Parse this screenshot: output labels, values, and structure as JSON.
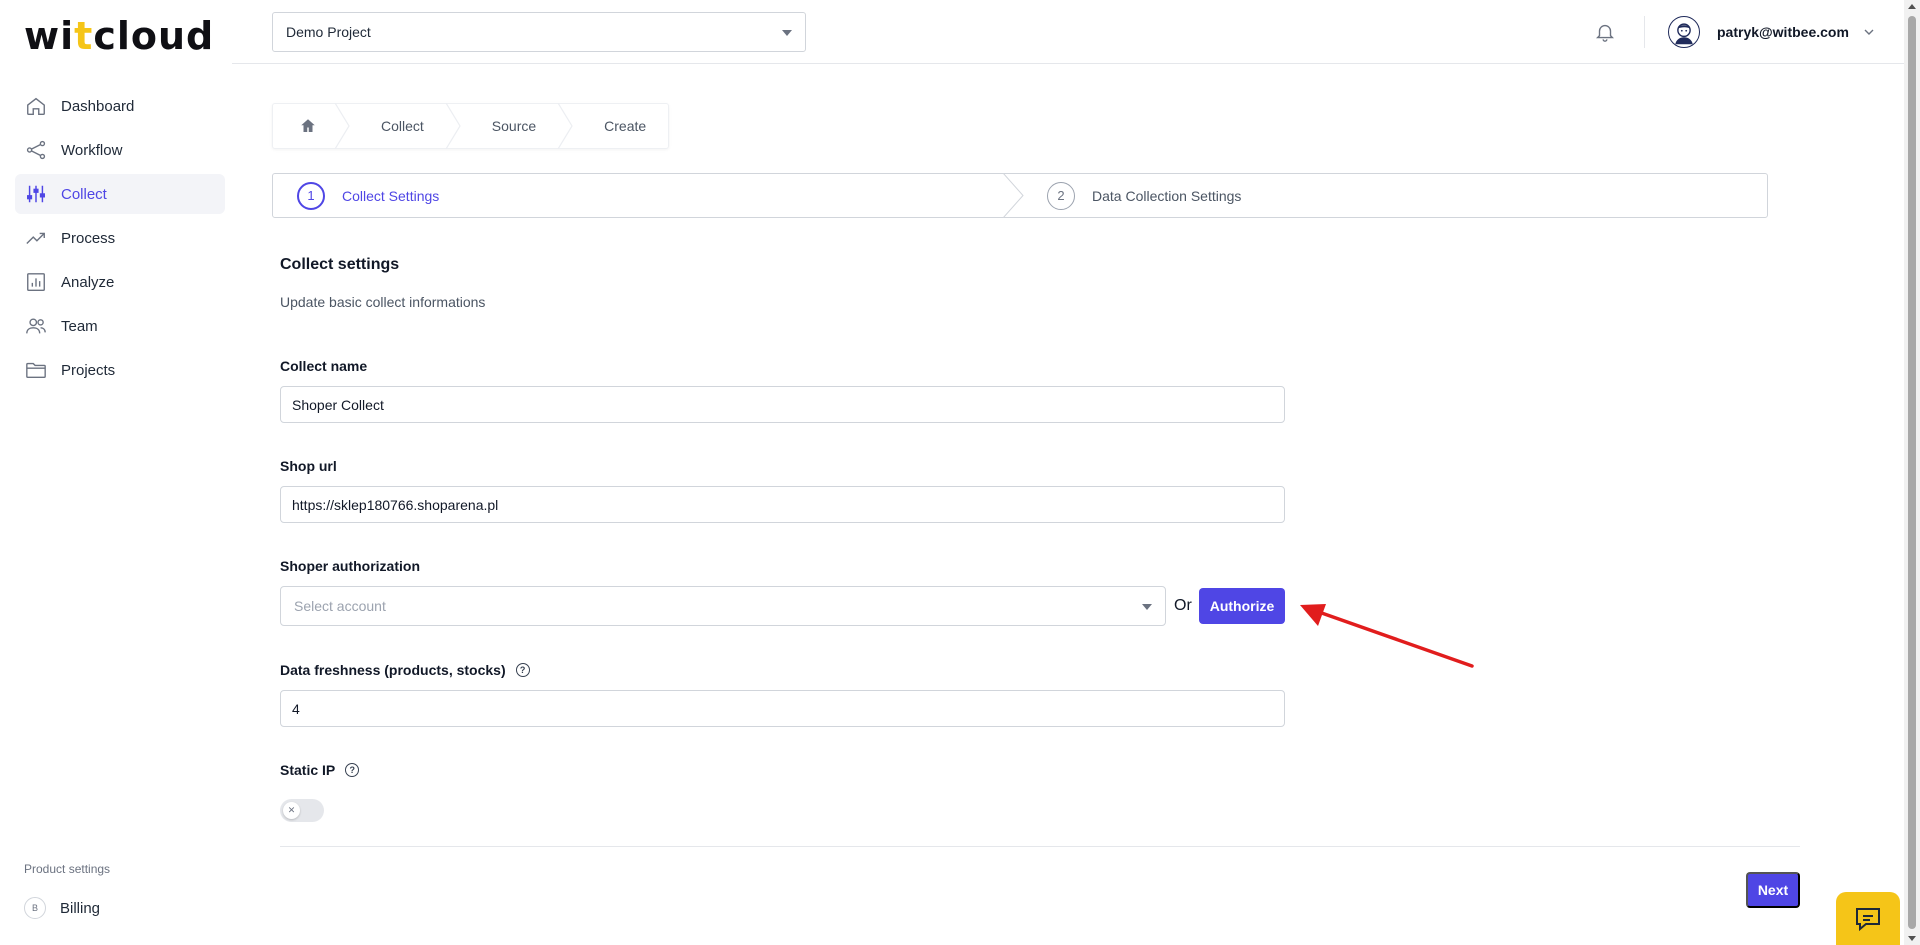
{
  "brand": {
    "logo_pre": "wi",
    "logo_accent": "t",
    "logo_post": "cloud",
    "accent_color": "#f5c518",
    "primary_color": "#4f46e5"
  },
  "sidebar": {
    "items": [
      {
        "label": "Dashboard",
        "icon": "home-icon"
      },
      {
        "label": "Workflow",
        "icon": "share-nodes-icon"
      },
      {
        "label": "Collect",
        "icon": "sliders-icon",
        "active": true
      },
      {
        "label": "Process",
        "icon": "trending-up-icon"
      },
      {
        "label": "Analyze",
        "icon": "bar-chart-icon"
      },
      {
        "label": "Team",
        "icon": "users-icon"
      },
      {
        "label": "Projects",
        "icon": "folder-icon"
      }
    ],
    "section_label": "Product settings",
    "billing": {
      "badge": "B",
      "label": "Billing"
    }
  },
  "topbar": {
    "project": "Demo Project",
    "user_email": "patryk@witbee.com"
  },
  "breadcrumb": [
    "Collect",
    "Source",
    "Create"
  ],
  "stepper": [
    {
      "num": "1",
      "label": "Collect Settings",
      "active": true
    },
    {
      "num": "2",
      "label": "Data Collection Settings",
      "active": false
    }
  ],
  "form": {
    "title": "Collect settings",
    "subtitle": "Update basic collect informations",
    "collect_name": {
      "label": "Collect name",
      "value": "Shoper Collect"
    },
    "shop_url": {
      "label": "Shop url",
      "value": "https://sklep180766.shoparena.pl"
    },
    "authorization": {
      "label": "Shoper authorization",
      "placeholder": "Select account",
      "or": "Or",
      "button": "Authorize"
    },
    "data_freshness": {
      "label": "Data freshness (products, stocks)",
      "value": "4"
    },
    "static_ip": {
      "label": "Static IP",
      "enabled": false
    },
    "next_button": "Next"
  }
}
